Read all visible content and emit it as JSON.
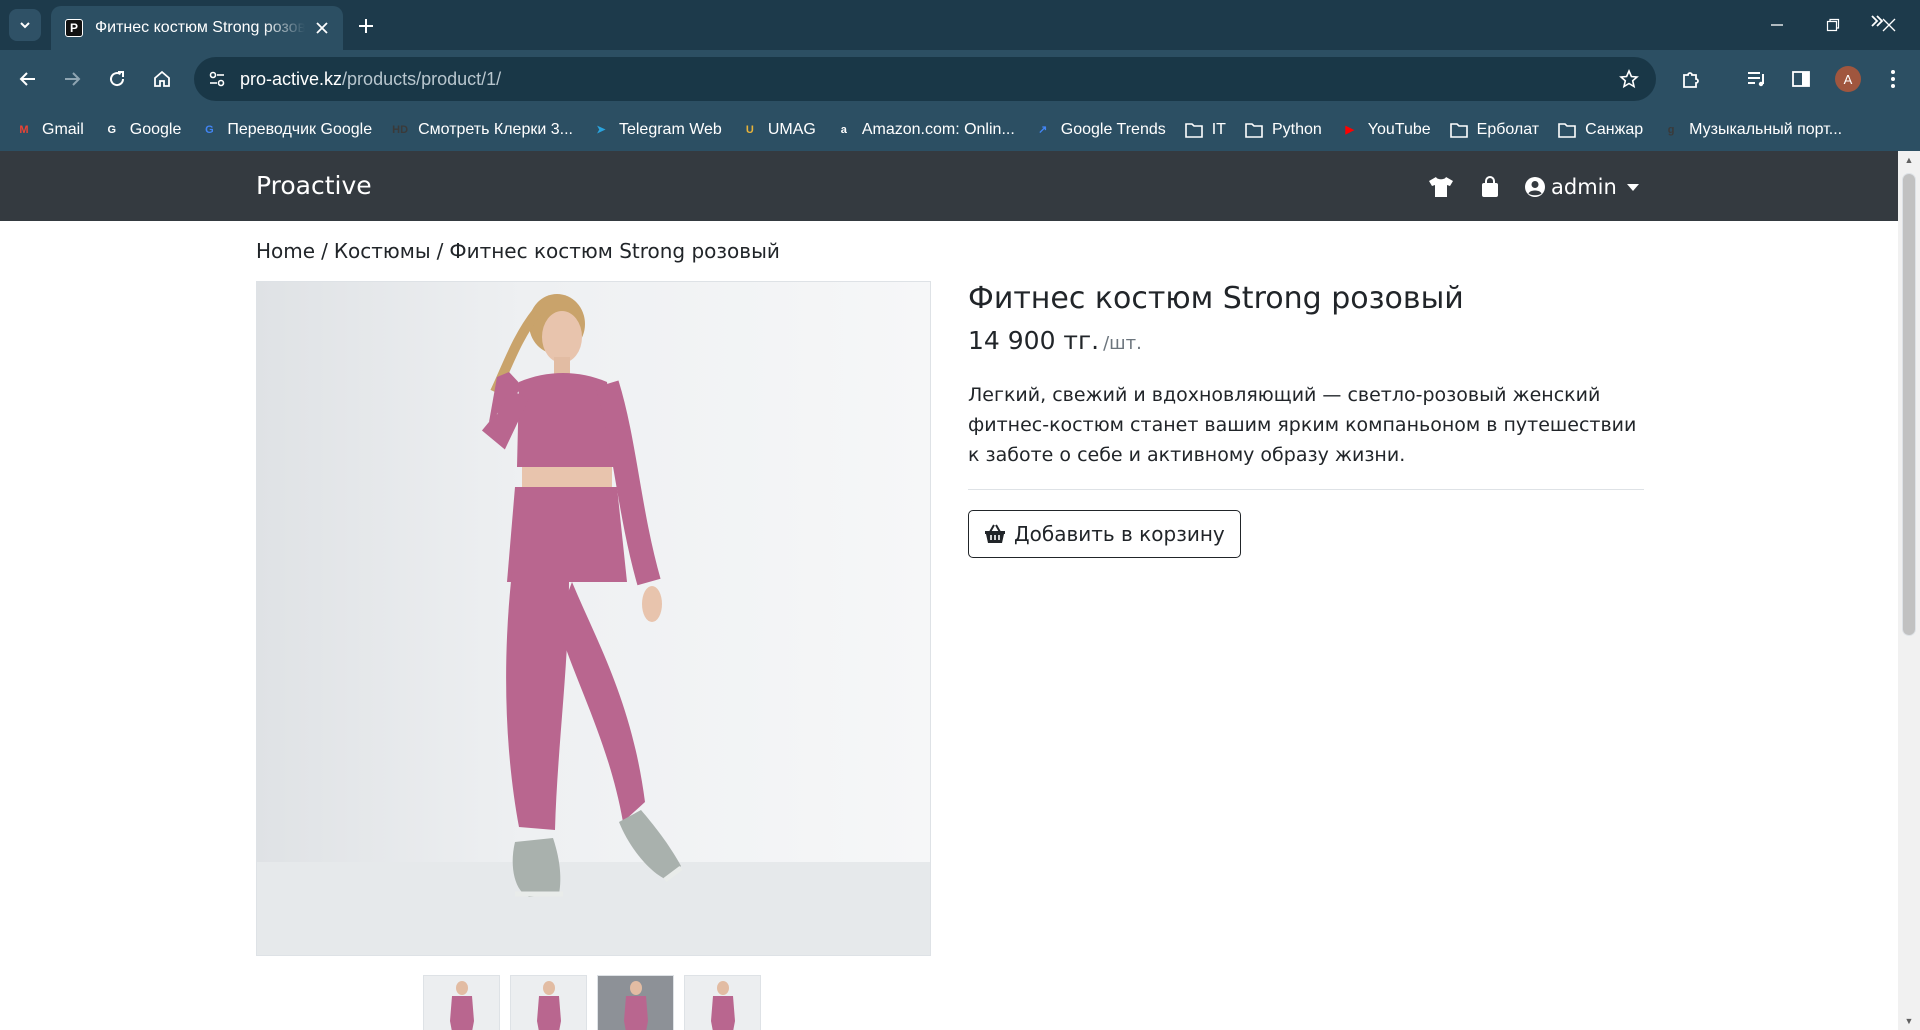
{
  "browser": {
    "tab_title": "Фитнес костюм Strong розовый",
    "tab_favicon": "P",
    "url_domain": "pro-active.kz",
    "url_path": "/products/product/1/",
    "profile_initial": "A",
    "bookmarks": [
      {
        "label": "Gmail",
        "icon": "gmail-icon",
        "color": "#ea4335",
        "glyph": "M"
      },
      {
        "label": "Google",
        "icon": "google-icon",
        "color": "#ffffff",
        "glyph": "G"
      },
      {
        "label": "Переводчик Google",
        "icon": "google-translate-icon",
        "color": "#4285f4",
        "glyph": "G"
      },
      {
        "label": "Смотреть Клерки 3...",
        "icon": "hd-icon",
        "color": "#3a3a3a",
        "glyph": "HD"
      },
      {
        "label": "Telegram Web",
        "icon": "telegram-icon",
        "color": "#2aa3dd",
        "glyph": "➤"
      },
      {
        "label": "UMAG",
        "icon": "umag-icon",
        "color": "#e8b33a",
        "glyph": "U"
      },
      {
        "label": "Amazon.com: Onlin...",
        "icon": "amazon-icon",
        "color": "#ffffff",
        "glyph": "a"
      },
      {
        "label": "Google Trends",
        "icon": "google-trends-icon",
        "color": "#4285f4",
        "glyph": "↗"
      },
      {
        "label": "IT",
        "icon": "folder-icon",
        "color": "",
        "glyph": ""
      },
      {
        "label": "Python",
        "icon": "folder-icon",
        "color": "",
        "glyph": ""
      },
      {
        "label": "YouTube",
        "icon": "youtube-icon",
        "color": "#ff0000",
        "glyph": "▶"
      },
      {
        "label": "Ерболат",
        "icon": "folder-icon",
        "color": "",
        "glyph": ""
      },
      {
        "label": "Санжар",
        "icon": "folder-icon",
        "color": "",
        "glyph": ""
      },
      {
        "label": "Музыкальный порт...",
        "icon": "music-portal-icon",
        "color": "#3a3a3a",
        "glyph": "g"
      }
    ]
  },
  "site": {
    "brand": "Proactive",
    "user": "admin",
    "nav_bg": "#343a40"
  },
  "breadcrumb": {
    "home": "Home",
    "sep": "/",
    "category": "Костюмы",
    "current": "Фитнес костюм Strong розовый"
  },
  "product": {
    "title": "Фитнес костюм Strong розовый",
    "price": "14 900 тг.",
    "unit": "/шт.",
    "description": "Легкий, свежий и вдохновляющий — светло-розовый женский фитнес-костюм станет вашим ярким компаньоном в путешествии к заботе о себе и активному образу жизни.",
    "add_to_cart": "Добавить в корзину",
    "suit_color": "#b9668f",
    "thumbnail_count": 4
  }
}
